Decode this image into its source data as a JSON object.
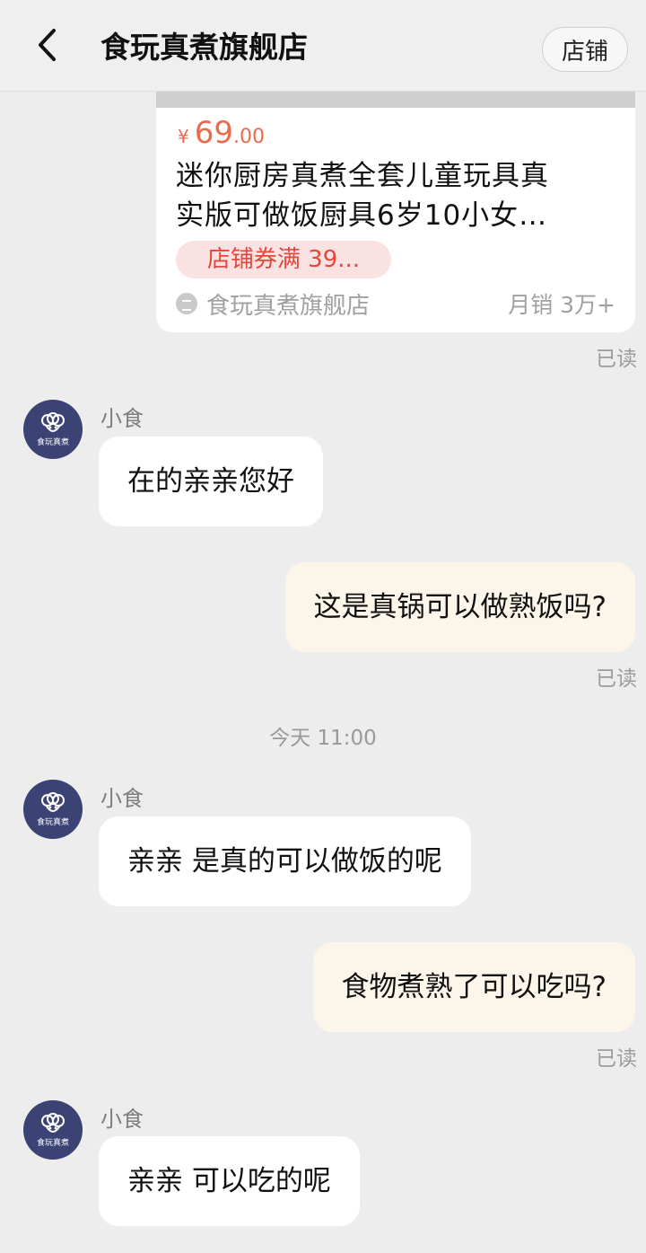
{
  "header": {
    "title": "食玩真煮旗舰店",
    "shop_button": "店铺"
  },
  "product": {
    "price_symbol": "¥",
    "price_int": "69",
    "price_dec": ".00",
    "title_line1": "迷你厨房真煮全套儿童玩具真",
    "title_line2": "实版可做饭厨具6岁10小女…",
    "coupon": "店铺券满 39...",
    "store_name": "食玩真煮旗舰店",
    "monthly_sales": "月销 3万+"
  },
  "avatar_text": "食玩真煮",
  "messages": [
    {
      "read": "已读"
    },
    {
      "sender": "小食",
      "text": "在的亲亲您好"
    },
    {
      "text": "这是真锅可以做熟饭吗?",
      "read": "已读"
    },
    {
      "divider": "今天 11:00"
    },
    {
      "sender": "小食",
      "text": "亲亲 是真的可以做饭的呢"
    },
    {
      "text": "食物煮熟了可以吃吗?",
      "read": "已读"
    },
    {
      "sender": "小食",
      "text": "亲亲 可以吃的呢"
    }
  ]
}
